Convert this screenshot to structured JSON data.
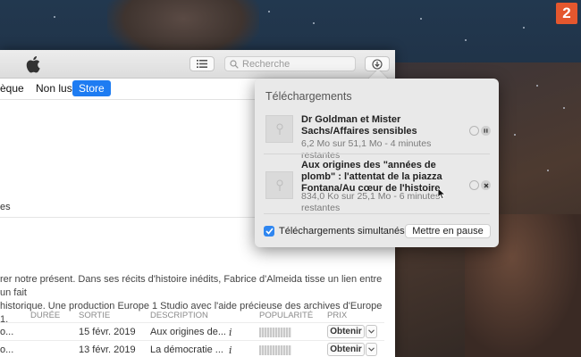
{
  "badge": "2",
  "toolbar": {
    "search_placeholder": "Recherche",
    "list_icon": "list-icon",
    "download_icon": "download-arrow-icon"
  },
  "nav": {
    "items": [
      {
        "label": "èque",
        "active": false
      },
      {
        "label": "Non lus",
        "active": false
      },
      {
        "label": "Store",
        "active": true
      }
    ]
  },
  "sidebar_tail": "es",
  "description": {
    "line1": "rer notre présent. Dans ses récits d'histoire inédits, Fabrice d'Almeida tisse un lien entre un fait",
    "line2": "historique. Une production Europe 1 Studio avec l'aide précieuse des archives d'Europe 1."
  },
  "table": {
    "headers": [
      "DURÉE",
      "SORTIE",
      "DESCRIPTION",
      "POPULARITÉ",
      "PRIX"
    ],
    "rows": [
      {
        "title": "o...",
        "date": "15 févr. 2019",
        "description": "Aux origines de...",
        "info": "i",
        "button": "Obtenir"
      },
      {
        "title": "o...",
        "date": "13 févr. 2019",
        "description": "La démocratie ...",
        "info": "i",
        "button": "Obtenir"
      }
    ]
  },
  "downloads": {
    "title": "Téléchargements",
    "items": [
      {
        "name": "Dr Goldman et Mister Sachs/Affaires sensibles",
        "progress": "6,2 Mo sur 51,1 Mo - 4 minutes restantes",
        "control": "pause-icon"
      },
      {
        "name": "Aux origines des \"années de plomb\" : l'attentat de la piazza Fontana/Au cœur de l'histoire",
        "progress": "834,0 Ko sur 25,1 Mo - 6 minutes restantes",
        "control": "cancel-icon"
      }
    ],
    "simultaneous_label": "Téléchargements simultanés",
    "simultaneous_checked": true,
    "pause_button": "Mettre en pause"
  },
  "colors": {
    "accent": "#1e7cf2",
    "badge": "#e4572e",
    "popover_bg": "#e9e9e9"
  }
}
